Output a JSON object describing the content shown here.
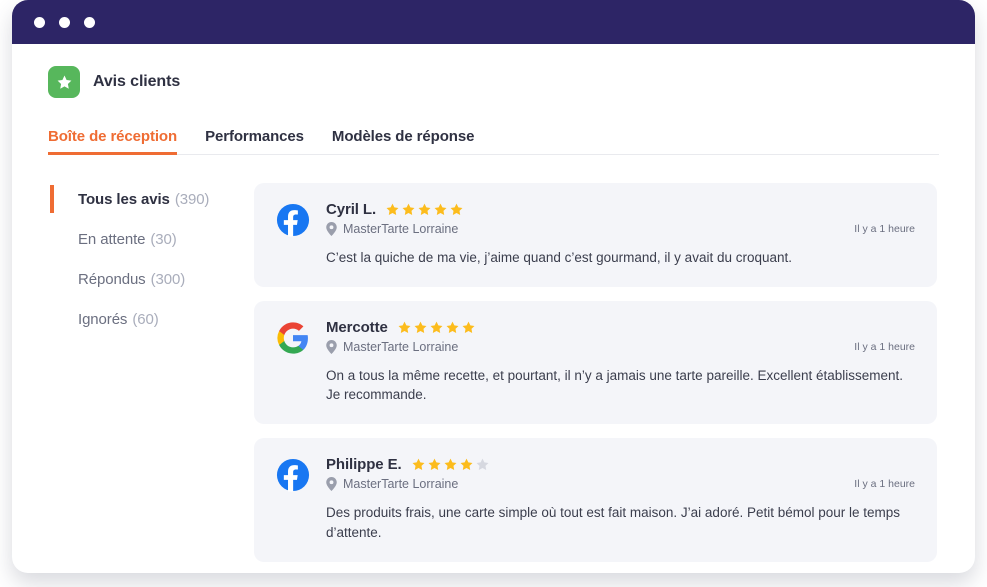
{
  "window": {
    "dots": [
      "window-dot-1",
      "window-dot-2",
      "window-dot-3"
    ],
    "titlebar_color": "#2d2566"
  },
  "header": {
    "logo_icon": "star-badge-icon",
    "logo_color": "#57b75c",
    "title": "Avis clients"
  },
  "tabs": {
    "accent_color": "#ef6c33",
    "items": [
      {
        "label": "Boîte de réception",
        "active": true
      },
      {
        "label": "Performances",
        "active": false
      },
      {
        "label": "Modèles de réponse",
        "active": false
      }
    ]
  },
  "sidebar": {
    "items": [
      {
        "label": "Tous les avis",
        "count": "(390)",
        "active": true
      },
      {
        "label": "En attente",
        "count": "(30)",
        "active": false
      },
      {
        "label": "Répondus",
        "count": "(300)",
        "active": false
      },
      {
        "label": "Ignorés",
        "count": "(60)",
        "active": false
      }
    ]
  },
  "reviews": [
    {
      "source": "facebook",
      "author": "Cyril L.",
      "rating": 5,
      "max_rating": 5,
      "location": "MasterTarte Lorraine",
      "time": "Il y a 1 heure",
      "text": "C’est la quiche de ma vie, j’aime quand c’est gourmand, il y avait du croquant."
    },
    {
      "source": "google",
      "author": "Mercotte",
      "rating": 5,
      "max_rating": 5,
      "location": "MasterTarte Lorraine",
      "time": "Il y a 1 heure",
      "text": "On a tous la même recette, et pourtant, il n’y a jamais une tarte pareille. Excellent établissement. Je recommande."
    },
    {
      "source": "facebook",
      "author": "Philippe E.",
      "rating": 4,
      "max_rating": 5,
      "location": "MasterTarte Lorraine",
      "time": "Il y a 1 heure",
      "text": "Des produits frais, une carte simple où tout est fait maison. J’ai adoré. Petit bémol pour le temps d’attente."
    }
  ],
  "colors": {
    "star_filled": "#fcbc1d",
    "star_empty": "#d6d8e0",
    "card_background": "#f4f5f9",
    "facebook_blue": "#1877f2"
  }
}
